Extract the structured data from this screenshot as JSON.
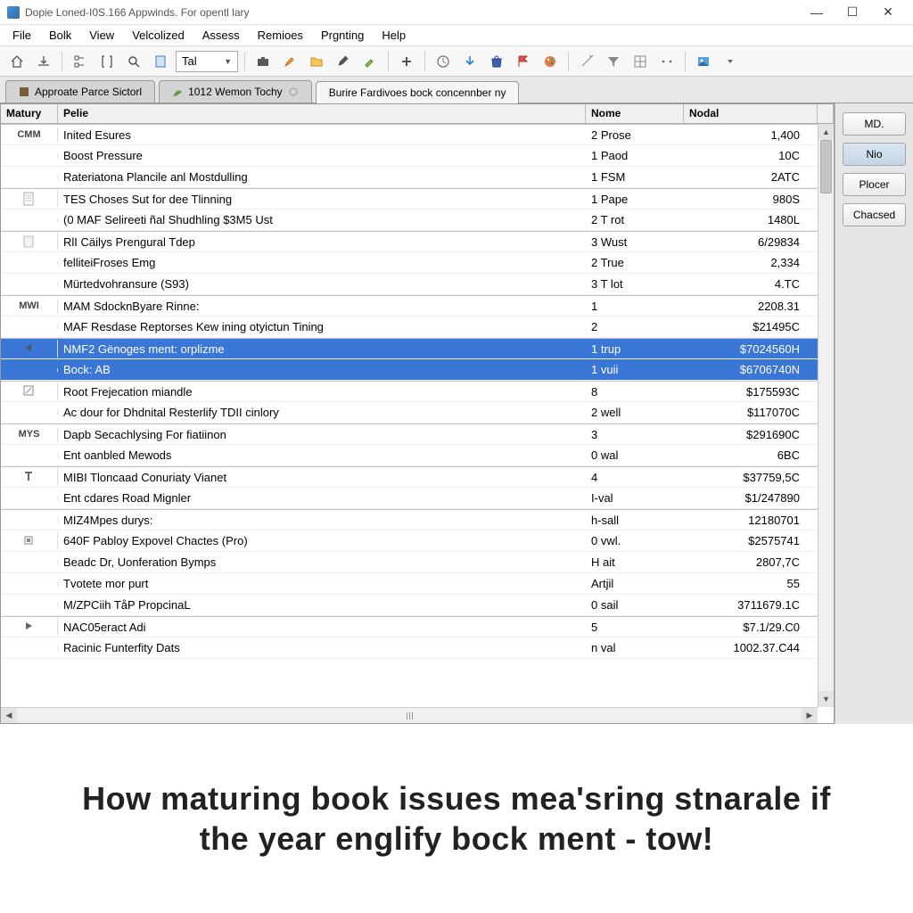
{
  "window": {
    "title": "Dopie Loned-I0S.166 Appwinds. For opentl lary"
  },
  "menubar": [
    "File",
    "Bolk",
    "View",
    "Velcolized",
    "Assess",
    "Remioes",
    "Prgnting",
    "Help"
  ],
  "toolbar": {
    "combo_value": "Tal"
  },
  "tabs": [
    {
      "label": "Approate Parce Sictorl",
      "active": false
    },
    {
      "label": "1012 Wemon Tochy",
      "active": false
    },
    {
      "label": "Burire Fardivoes bock concennber ny",
      "active": true
    }
  ],
  "grid": {
    "headers": {
      "matury": "Matury",
      "pelie": "Pelie",
      "nome": "Nome",
      "nodal": "Nodal"
    },
    "rows": [
      {
        "mat": "CMM",
        "icon": "cyl",
        "pelie": "Inited Esures",
        "nome": "2 Prose",
        "nodal": "1,400",
        "group_start": true
      },
      {
        "mat": "",
        "icon": "",
        "pelie": "Boost Pressure",
        "nome": "1 Paod",
        "nodal": "10C"
      },
      {
        "mat": "",
        "icon": "",
        "pelie": "Rateriatona Plancile anl Mostdulling",
        "nome": "1 FSM",
        "nodal": "2ATC"
      },
      {
        "mat": "",
        "icon": "doc",
        "pelie": "TES Choses Sut for dee Tlinning",
        "nome": "1 Pape",
        "nodal": "980S",
        "group_start": true
      },
      {
        "mat": "",
        "icon": "",
        "pelie": "(0 MAF Selireeti ñal Shudhling $3M5 Ust",
        "nome": "2 T rot",
        "nodal": "1480L"
      },
      {
        "mat": "",
        "icon": "file",
        "pelie": "RlI Cäilys Prengural Tdep",
        "nome": "3 Wust",
        "nodal": "6/29834",
        "group_start": true
      },
      {
        "mat": "",
        "icon": "",
        "pelie": "felliteiFroses Emg",
        "nome": "2 True",
        "nodal": "2,334"
      },
      {
        "mat": "",
        "icon": "",
        "pelie": "Mürtedvohransure (S93)",
        "nome": "3 T lot",
        "nodal": "4.TC"
      },
      {
        "mat": "MWI",
        "icon": "",
        "pelie": "MAM SdocknByare Rinne:",
        "nome": "1",
        "nodal": "2208.31",
        "group_start": true
      },
      {
        "mat": "",
        "icon": "",
        "pelie": "MAF Resdase Reptorses Kew ining otyictun Tining",
        "nome": "2",
        "nodal": "$21495C"
      },
      {
        "mat": "",
        "icon": "arrow-left",
        "pelie": "NMF2 Gënoges ment: orplizme",
        "nome": "1 trup",
        "nodal": "$7024560H",
        "selected": true,
        "group_start": true
      },
      {
        "mat": "",
        "icon": "",
        "pelie": "Bock: AB",
        "nome": "1 vuii",
        "nodal": "$6706740N",
        "selected": true
      },
      {
        "mat": "",
        "icon": "note",
        "pelie": "Root Frejecation miandle",
        "nome": "8",
        "nodal": "$175593C",
        "group_start": true
      },
      {
        "mat": "",
        "icon": "",
        "pelie": "Ac dour for Dhdnital Resterlify TDII cinlory",
        "nome": "2 well",
        "nodal": "$117070C"
      },
      {
        "mat": "MYS",
        "icon": "",
        "pelie": "Dapb Secachlysing For fiatiinon",
        "nome": "3",
        "nodal": "$291690C",
        "group_start": true
      },
      {
        "mat": "",
        "icon": "",
        "pelie": "Ent oanbled Mewods",
        "nome": "0 wal",
        "nodal": "6BC"
      },
      {
        "mat": "",
        "icon": "tee",
        "pelie": "MIBI Tloncaad Conuriaty Vianet",
        "nome": "4",
        "nodal": "$37759,5C",
        "group_start": true
      },
      {
        "mat": "",
        "icon": "",
        "pelie": "Ent cdares Road Mignler",
        "nome": "I-val",
        "nodal": "$1/247890"
      },
      {
        "mat": "",
        "icon": "",
        "pelie": "MIZ4Mpes durys:",
        "nome": "h-sall",
        "nodal": "12180701",
        "group_start": true
      },
      {
        "mat": "",
        "icon": "box",
        "pelie": "640F Pabloy Expovel Chactes (Pro)",
        "nome": "0 vwl.",
        "nodal": "$2575741"
      },
      {
        "mat": "",
        "icon": "",
        "pelie": "Beadc Dr, Uonferation Bymps",
        "nome": "H ait",
        "nodal": "2807,7C"
      },
      {
        "mat": "",
        "icon": "",
        "pelie": "Tvotete mor purt",
        "nome": "Artjil",
        "nodal": "55"
      },
      {
        "mat": "",
        "icon": "",
        "pelie": "M/ZPCiih TåP PropcinaL",
        "nome": "0 sail",
        "nodal": "3711679.1C"
      },
      {
        "mat": "",
        "icon": "play",
        "pelie": "NAC05eract Adi",
        "nome": "5",
        "nodal": "$7.1/29.C0",
        "group_start": true
      },
      {
        "mat": "",
        "icon": "",
        "pelie": "Racinic Funterfity Dats",
        "nome": "n val",
        "nodal": "1002.37.C44"
      }
    ]
  },
  "sidepanel": [
    {
      "label": "MD.",
      "active": false
    },
    {
      "label": "Nio",
      "active": true
    },
    {
      "label": "Plocer",
      "active": false
    },
    {
      "label": "Chacsed",
      "active": false
    }
  ],
  "caption": "How maturing book issues mea'sring stnarale if the year englify bock ment - tow!"
}
